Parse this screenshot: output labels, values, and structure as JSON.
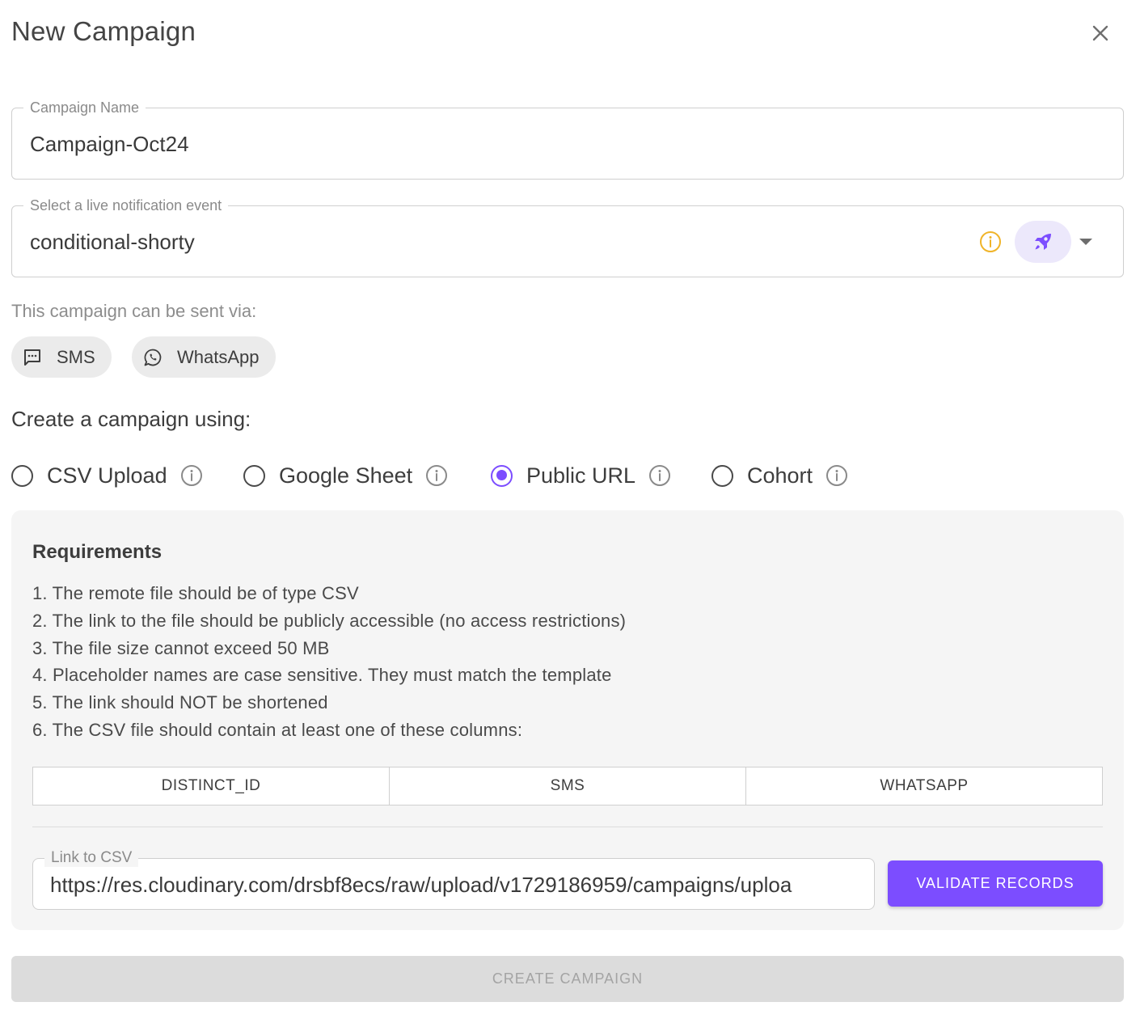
{
  "dialog": {
    "title": "New Campaign"
  },
  "campaign_name": {
    "label": "Campaign Name",
    "value": "Campaign-Oct24"
  },
  "event_select": {
    "label": "Select a live notification event",
    "value": "conditional-shorty"
  },
  "channels": {
    "heading": "This campaign can be sent via:",
    "items": [
      {
        "label": "SMS",
        "icon": "sms-icon"
      },
      {
        "label": "WhatsApp",
        "icon": "whatsapp-icon"
      }
    ]
  },
  "create_using": {
    "heading": "Create a campaign using:",
    "options": [
      {
        "label": "CSV Upload",
        "checked": false
      },
      {
        "label": "Google Sheet",
        "checked": false
      },
      {
        "label": "Public URL",
        "checked": true
      },
      {
        "label": "Cohort",
        "checked": false
      }
    ]
  },
  "requirements": {
    "title": "Requirements",
    "items": [
      "1. The remote file should be of type CSV",
      "2. The link to the file should be publicly accessible (no access restrictions)",
      "3. The file size cannot exceed 50 MB",
      "4. Placeholder names are case sensitive. They must match the template",
      "5. The link should NOT be shortened",
      "6. The CSV file should contain at least one of these columns:"
    ],
    "columns": [
      "DISTINCT_ID",
      "SMS",
      "WHATSAPP"
    ]
  },
  "link_to_csv": {
    "label": "Link to CSV",
    "value": "https://res.cloudinary.com/drsbf8ecs/raw/upload/v1729186959/campaigns/uploa"
  },
  "buttons": {
    "validate": "VALIDATE RECORDS",
    "create": "CREATE CAMPAIGN"
  },
  "colors": {
    "accent": "#7c4dff",
    "info_orange": "#f0b429",
    "rocket_bg": "#ece8fb"
  }
}
